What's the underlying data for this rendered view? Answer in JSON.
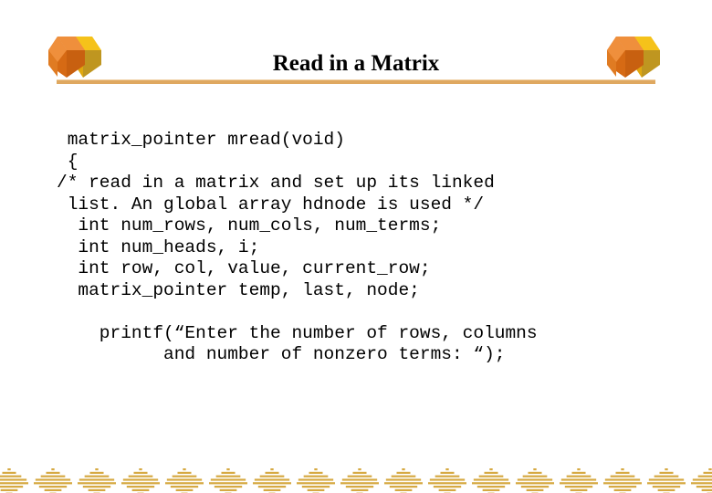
{
  "slide": {
    "title": "Read in a Matrix",
    "background_color": "#ffffff",
    "accent_color": "#dfa860",
    "text_color": "#000000"
  },
  "decorations": {
    "top_left_logo": "cube-logo-icon",
    "top_right_logo": "cube-logo-icon",
    "logo_colors": {
      "front_top": "#ef8f3c",
      "front_left": "#d66a14",
      "front_right": "#c86010",
      "back_top": "#f5c21a",
      "back_left": "#e0a80f",
      "back_right": "#bf9620"
    },
    "title_rule_color": "#dfa860",
    "bottom_band_icon": "diamond-band-icon",
    "bottom_band_color": "#d6a942"
  },
  "code": {
    "lines": [
      " matrix_pointer mread(void)",
      " {",
      "/* read in a matrix and set up its linked",
      " list. An global array hdnode is used */",
      "  int num_rows, num_cols, num_terms;",
      "  int num_heads, i;",
      "  int row, col, value, current_row;",
      "  matrix_pointer temp, last, node;",
      "",
      "    printf(“Enter the number of rows, columns",
      "          and number of nonzero terms: “);"
    ]
  }
}
